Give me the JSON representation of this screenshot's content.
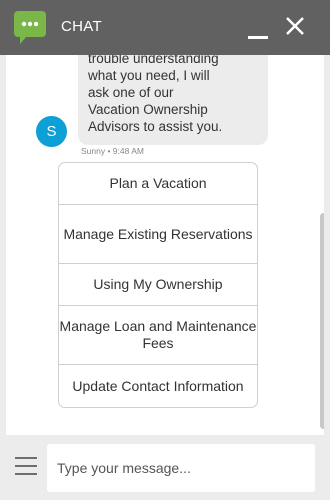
{
  "header": {
    "title": "CHAT",
    "logo_icon": "chat-bubble-icon",
    "minimize_icon": "minimize-icon",
    "close_icon": "close-icon",
    "background": "#616161",
    "logo_color": "#7ab648"
  },
  "message": {
    "text_partial_top": "trouble understanding",
    "lines": [
      "what you need, I will",
      "ask one of our",
      "Vacation Ownership",
      "Advisors to assist you."
    ],
    "avatar_letter": "S",
    "avatar_color": "#0ca0d6",
    "meta": "Sunny • 9:48 AM"
  },
  "options": [
    {
      "label": "Plan a Vacation"
    },
    {
      "label": "Manage Existing Reservations"
    },
    {
      "label": "Using My Ownership"
    },
    {
      "label": "Manage Loan and Maintenance Fees"
    },
    {
      "label": "Update Contact Information"
    }
  ],
  "composer": {
    "placeholder": "Type your message...",
    "menu_icon": "hamburger-menu-icon"
  }
}
